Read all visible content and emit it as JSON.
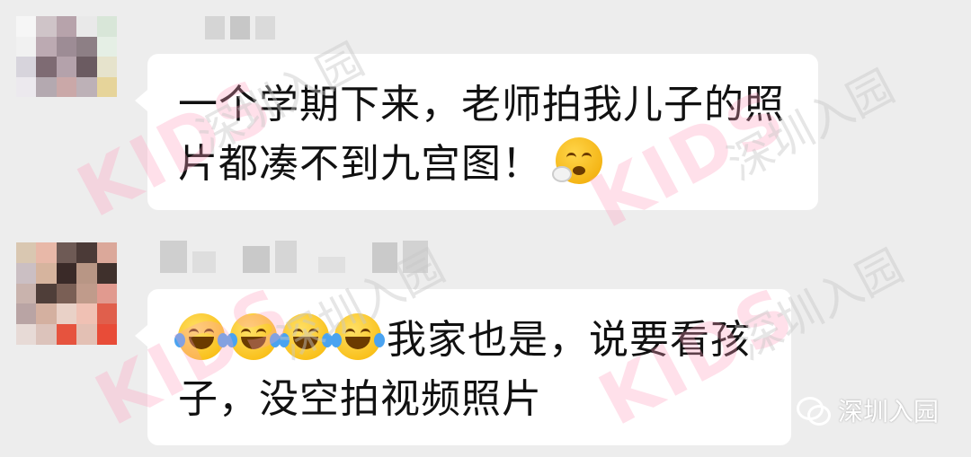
{
  "messages": [
    {
      "lines": [
        "一个学期下来，老师拍我儿子的照",
        "片都凑不到九宫图！"
      ],
      "emoji": "sleepy-face-emoji"
    },
    {
      "emoji_prefix": [
        "joy-emoji",
        "joy-emoji",
        "joy-emoji",
        "joy-emoji"
      ],
      "line1": "我家也是，说要看孩",
      "line2": "子，没空拍视频照片"
    }
  ],
  "watermark": {
    "brand_text": "KIDS",
    "cn_text": "深圳入园"
  },
  "footer": {
    "source_label": "深圳入园"
  },
  "colors": {
    "background": "#ededed",
    "bubble": "#ffffff",
    "text": "#111111"
  }
}
